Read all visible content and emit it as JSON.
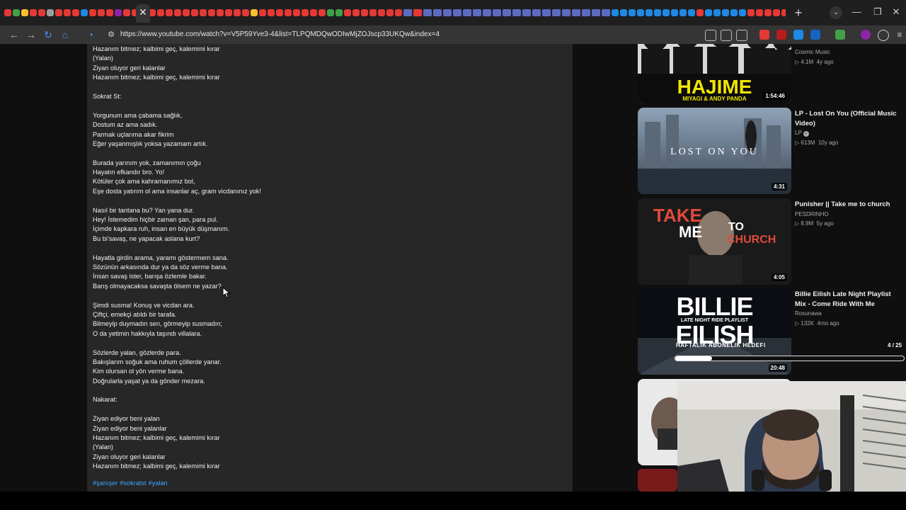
{
  "browser": {
    "url": "https://www.youtube.com/watch?v=V5P59Yve3-4&list=TLPQMDQwODIwMjZOJscp33UKQw&index=4",
    "close_tab": "✕",
    "new_tab": "+",
    "tab_search": "⌄",
    "window": {
      "minimize": "—",
      "restore": "❐",
      "close": "✕"
    },
    "nav": {
      "back": "←",
      "forward": "→",
      "reload": "↻",
      "home": "⌂"
    }
  },
  "description": {
    "lines": [
      "Hazanım bitmez; kalbimi geç, kalemimi kırar",
      "(Yalan)",
      "Ziyan oluyor geri kalanlar",
      "Hazanım bitmez; kalbimi geç, kalemimi kırar",
      "",
      "Sokrat St:",
      "",
      "Yorgunum ama çabama sağlık,",
      "Dostum az ama sadık.",
      "Parmak uçlarıma akar fikrim",
      "Eğer yaşanmışlık yoksa yazamam artık.",
      "",
      "Burada yarınım yok, zamanımın çoğu",
      "Hayatın efkandır bro. Yo!",
      "Kötüler çok ama kahramanımız bol,",
      "Eşe dosta yatırım ol ama insanlar aç, gram vicdanınız yok!",
      "",
      "Nasıl bir tantana bu? Yan yana dur.",
      "Hey! İstemedim hiçbir zaman şan, para pul.",
      "İçimde kapkara ruh, insan en büyük düşmanım.",
      "Bu bi'savaş, ne yapacak aslana kurt?",
      "",
      "Hayatla girdin arama, yaramı göstermem sana.",
      "Sözünün arkasında dur ya da söz verme bana.",
      "İnsan savaş ister, barışa özlemle bakar.",
      "Barış olmayacaksa savaşta ölsem ne yazar?",
      "",
      "Şimdi susma! Konuş ve vicdan ara.",
      "Çiftçi, emekçi atıldı bir tarafa.",
      "Bilmeyip duymadın sen, görmeyip susmadın;",
      "O da yetimin hakkıyla taşındı villalara.",
      "",
      "Sözlerde yalan, gözlerde para.",
      "Bakışlarım soğuk ama ruhum çöllerde yanar.",
      "Kim olursan ol yön verme bana.",
      "Doğrularla yaşat ya da gönder mezara.",
      "",
      "Nakarat:",
      "",
      "Ziyan ediyor beni yalan",
      "Ziyan ediyor beni yalanlar",
      "Hazanım bitmez; kalbimi geç, kalemimi kırar",
      "(Yalan)",
      "Ziyan oluyor geri kalanlar",
      "Hazanım bitmez; kalbimi geç, kalemimi kırar"
    ],
    "hashtags": [
      "#şanışer",
      "#sokratst",
      "#yalan"
    ]
  },
  "recommendations": [
    {
      "thumb_text": "HAJIME",
      "thumb_sub": "MIYAGI & ANDY PANDA",
      "duration": "1:54:46",
      "channel": "Cosmic Music",
      "views": "4.1M",
      "age": "4y ago"
    },
    {
      "title": "LP - Lost On You (Official Music Video)",
      "thumb_text": "LOST ON YOU",
      "duration": "4:31",
      "channel": "LP",
      "views": "613M",
      "age": "10y ago"
    },
    {
      "title": "Punisher || Take me to church",
      "thumb_text_a": "TAKE",
      "thumb_text_b": "ME",
      "thumb_text_c": "TO",
      "thumb_text_d": "CHURCH",
      "duration": "4:05",
      "channel": "PESDRINHO",
      "views": "8.9M",
      "age": "5y ago"
    },
    {
      "title": "Billie Eilish Late Night Playlist Mix - Come Ride With Me",
      "thumb_text": "BILLIE EILISH",
      "thumb_sub": "LATE NIGHT RIDE PLAYLIST",
      "duration": "20:48",
      "channel": "Rosunawa",
      "views": "132K",
      "age": "4mo ago"
    }
  ],
  "overlay": {
    "label": "HAFTALIK ABONELIK HEDEFI",
    "count": "4 / 25",
    "progress": 0.16
  },
  "colors": {
    "background": "#0f0f0f",
    "panel": "#272727",
    "hashtag": "#3ea6ff",
    "secondary_text": "#aaaaaa"
  }
}
